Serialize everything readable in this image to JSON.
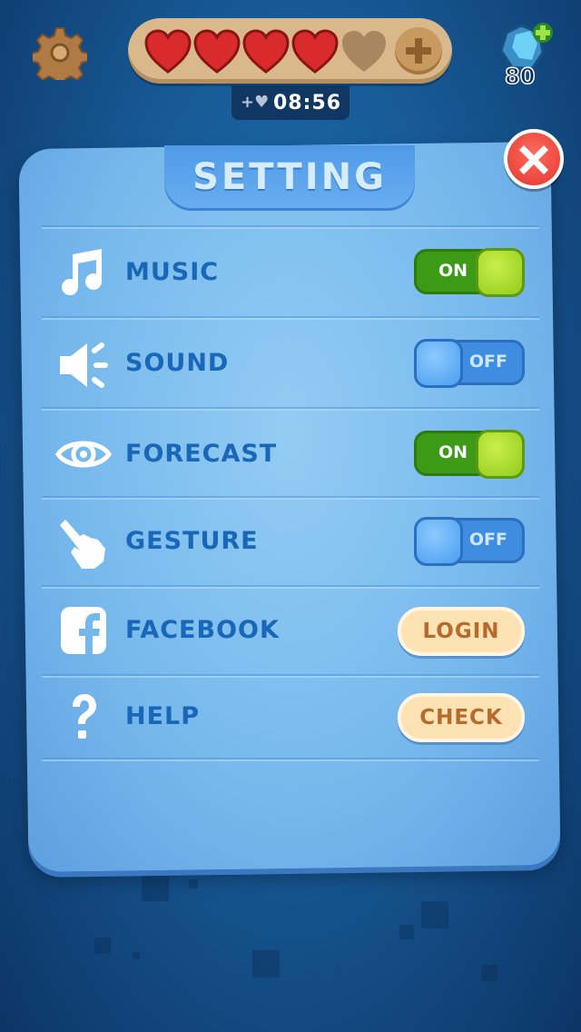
{
  "hud": {
    "lives_filled": 4,
    "lives_total": 5,
    "timer": "08:56",
    "gems": "80"
  },
  "dialog": {
    "title": "SETTING",
    "rows": [
      {
        "icon": "music-note-icon",
        "label": "MUSIC",
        "control": "toggle",
        "state": "ON"
      },
      {
        "icon": "speaker-icon",
        "label": "SOUND",
        "control": "toggle",
        "state": "OFF"
      },
      {
        "icon": "eye-icon",
        "label": "FORECAST",
        "control": "toggle",
        "state": "ON"
      },
      {
        "icon": "pointing-hand-icon",
        "label": "GESTURE",
        "control": "toggle",
        "state": "OFF"
      },
      {
        "icon": "facebook-icon",
        "label": "FACEBOOK",
        "control": "button",
        "button_label": "LOGIN"
      },
      {
        "icon": "question-mark-icon",
        "label": "HELP",
        "control": "button",
        "button_label": "CHECK"
      }
    ]
  },
  "colors": {
    "panel": "#76b8ec",
    "label": "#1867b8",
    "toggle_on": "#3c9a16",
    "toggle_off": "#3e8de0",
    "pill": "#fde3b3",
    "pill_text": "#b66a2e",
    "close": "#e2372e"
  }
}
